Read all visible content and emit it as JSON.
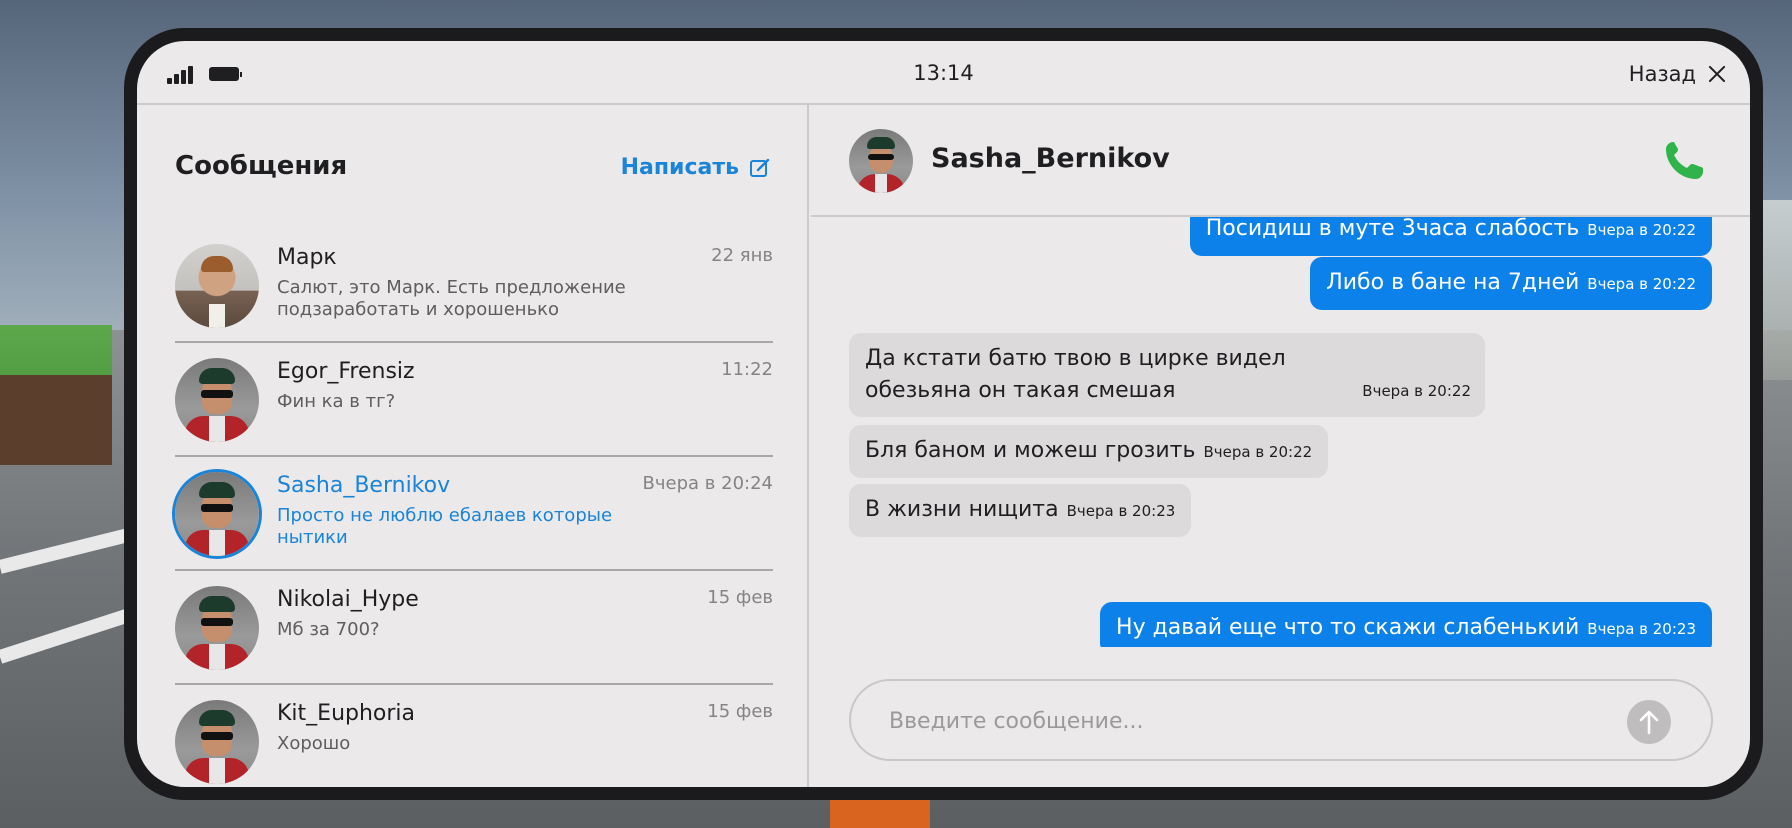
{
  "status_bar": {
    "time": "13:14",
    "back_label": "Назад"
  },
  "left": {
    "title": "Сообщения",
    "compose_label": "Написать",
    "conversations": [
      {
        "name": "Марк",
        "preview": "Салют, это Марк. Есть предложение подзаработать и хорошенько",
        "time": "22 янв",
        "avatar": "portrait-photo"
      },
      {
        "name": "Egor_Frensiz",
        "preview": "Фин ка в тг?",
        "time": "11:22",
        "avatar": "game-character"
      },
      {
        "name": "Sasha_Bernikov",
        "preview": "Просто не люблю ебалаев которые нытики",
        "time": "Вчера в 20:24",
        "avatar": "game-character"
      },
      {
        "name": "Nikolai_Hype",
        "preview": "Мб за 700?",
        "time": "15 фев",
        "avatar": "game-character"
      },
      {
        "name": "Kit_Euphoria",
        "preview": "Хорошо",
        "time": "15 фев",
        "avatar": "game-character"
      }
    ]
  },
  "chat": {
    "contact_name": "Sasha_Bernikov",
    "messages": [
      {
        "text": "Посидиш в муте 3часа слабость",
        "time": "Вчера в 20:22",
        "direction": "out"
      },
      {
        "text": "Либо в бане на 7дней",
        "time": "Вчера в 20:22",
        "direction": "out"
      },
      {
        "text": "Да кстати батю твою в цирке видел обезьяна он такая смешая",
        "time": "Вчера в 20:22",
        "direction": "in"
      },
      {
        "text": "Бля баном и можеш грозить",
        "time": "Вчера в 20:22",
        "direction": "in"
      },
      {
        "text": "В жизни нищита",
        "time": "Вчера в 20:23",
        "direction": "in"
      },
      {
        "text": "Ну давай еще что то скажи слабенький",
        "time": "Вчера в 20:23",
        "direction": "out"
      }
    ],
    "input_placeholder": "Введите сообщение..."
  },
  "colors": {
    "accent": "#0d81ea",
    "call_green": "#2fb34a",
    "panel_bg": "#ebe9ea"
  }
}
